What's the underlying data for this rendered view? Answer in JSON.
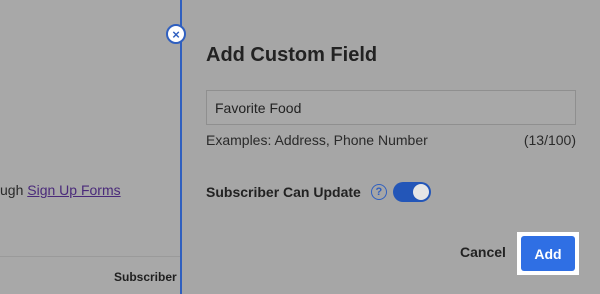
{
  "background": {
    "text_prefix": "ugh ",
    "link_text": "Sign Up Forms",
    "column_header": "Subscriber C"
  },
  "panel": {
    "title": "Add Custom Field",
    "close_icon": "×",
    "field": {
      "value": "Favorite Food",
      "hint": "Examples: Address, Phone Number",
      "counter": "(13/100)"
    },
    "toggle": {
      "label": "Subscriber Can Update",
      "help_icon": "?",
      "state": "on"
    },
    "cancel_label": "Cancel",
    "add_label": "Add"
  },
  "colors": {
    "accent": "#2f6fe4",
    "panel_border": "#2f5fbf",
    "overlay": "#a8a8a8"
  }
}
